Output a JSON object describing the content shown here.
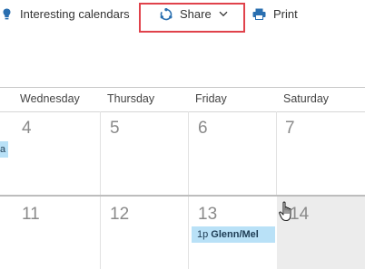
{
  "toolbar": {
    "interesting_label": "Interesting calendars",
    "share_label": "Share",
    "print_label": "Print"
  },
  "calendar": {
    "day_headers": [
      "Wednesday",
      "Thursday",
      "Friday",
      "Saturday"
    ],
    "week1_dates": [
      "4",
      "5",
      "6",
      "7"
    ],
    "week2_dates": [
      "11",
      "12",
      "13",
      "14"
    ],
    "events": {
      "partial_chip_text": "a",
      "glenn_time": "1p",
      "glenn_title": "Glenn/Mel"
    }
  },
  "colors": {
    "highlight_border": "#e0424b",
    "event_bg": "#b9e1f7",
    "accent_icon": "#2a6fb0"
  }
}
